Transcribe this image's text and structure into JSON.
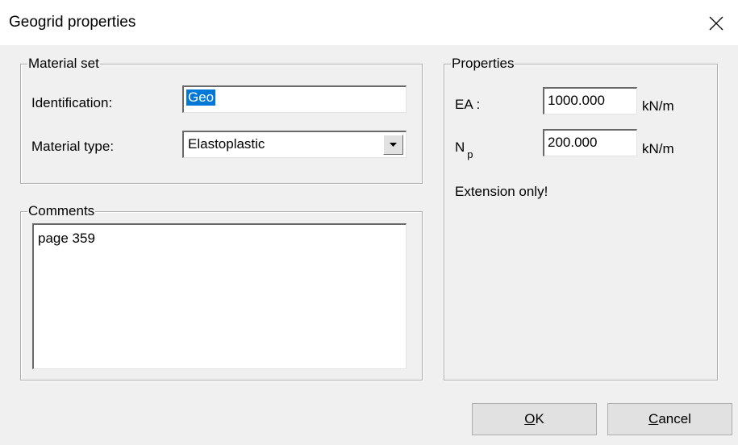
{
  "window": {
    "title": "Geogrid properties",
    "close_icon": "close-icon"
  },
  "material_set": {
    "legend": "Material set",
    "identification_label": "Identification:",
    "identification_value": "Geo",
    "material_type_label": "Material type:",
    "material_type_value": "Elastoplastic",
    "dropdown_icon": "chevron-down-icon"
  },
  "comments": {
    "legend": "Comments",
    "text": "page 359"
  },
  "properties": {
    "legend": "Properties",
    "ea_label": "EA :",
    "ea_value": "1000.000",
    "ea_unit": "kN/m",
    "np_label_main": "N",
    "np_label_sub": "p",
    "np_value": "200.000",
    "np_unit": "kN/m",
    "note": "Extension only!"
  },
  "buttons": {
    "ok": "OK",
    "cancel": "Cancel"
  }
}
